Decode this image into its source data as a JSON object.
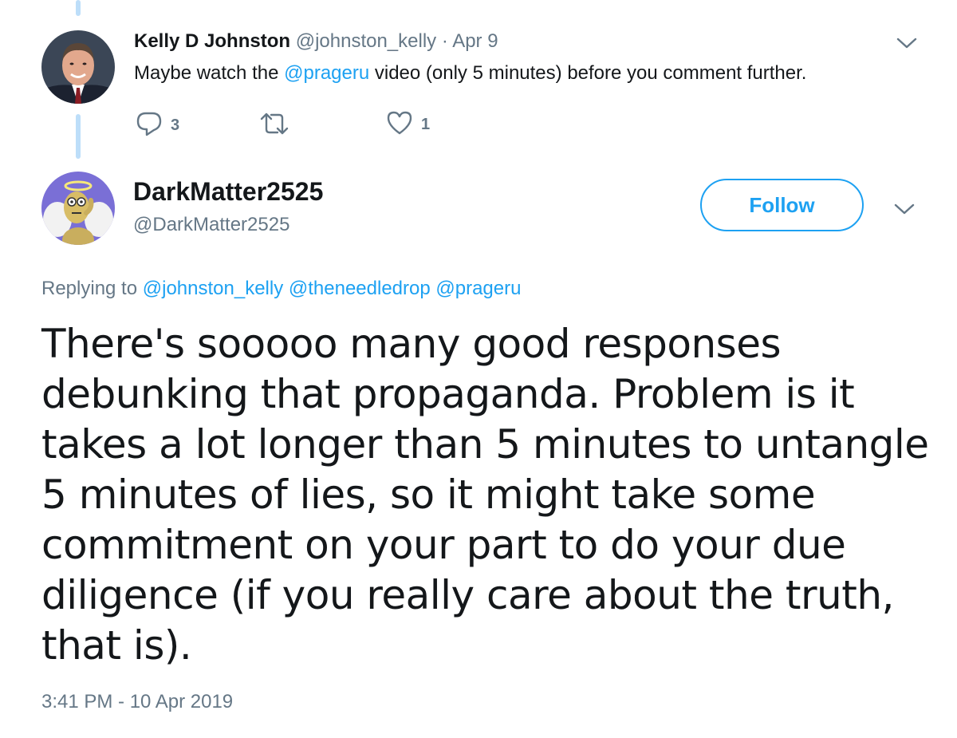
{
  "parent_tweet": {
    "author_name": "Kelly D Johnston",
    "author_handle": "@johnston_kelly",
    "separator": "·",
    "date": "Apr 9",
    "text_before": "Maybe watch the ",
    "mention": "@prageru",
    "text_after": " video (only 5 minutes) before you comment further.",
    "reply_count": "3",
    "retweet_count": "",
    "like_count": "1"
  },
  "main_tweet": {
    "author_name": "DarkMatter2525",
    "author_handle": "@DarkMatter2525",
    "follow_label": "Follow",
    "replying_prefix": "Replying to ",
    "replying_mentions": "@johnston_kelly @theneedledrop @prageru",
    "text": "There's sooooo many good responses\ndebunking that propaganda. Problem is it\ntakes a lot longer than 5 minutes to untangle\n5 minutes of lies, so it might take some\ncommitment on your part to do your due\ndiligence (if you really care about the truth,\nthat is).",
    "timestamp": "3:41 PM - 10 Apr 2019"
  },
  "icons": {
    "reply": "reply-icon",
    "retweet": "retweet-icon",
    "like": "heart-icon",
    "menu": "chevron-down-icon"
  },
  "colors": {
    "accent": "#1da1f2",
    "muted": "#657786",
    "thread_line": "#bddef9",
    "text": "#14171a"
  }
}
